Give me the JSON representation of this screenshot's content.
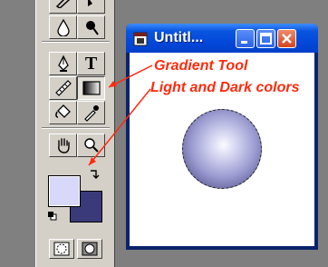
{
  "document_window": {
    "title": "Untitl...",
    "buttons": [
      "minimize",
      "maximize",
      "close"
    ]
  },
  "toolbox": {
    "tools": [
      {
        "name": "pencil-tool",
        "icon": "pencil-icon"
      },
      {
        "name": "bucket-tool",
        "icon": "bucket-icon"
      },
      {
        "name": "blur-tool",
        "icon": "drop-icon"
      },
      {
        "name": "burn-tool",
        "icon": "burn-icon"
      },
      {
        "name": "pen-tool",
        "icon": "pen-icon"
      },
      {
        "name": "type-tool",
        "icon": "type-icon"
      },
      {
        "name": "measure-tool",
        "icon": "ruler-icon"
      },
      {
        "name": "gradient-tool",
        "icon": "gradient-icon",
        "selected": true
      },
      {
        "name": "paint-bucket-tool",
        "icon": "paint-bucket-icon"
      },
      {
        "name": "eyedropper-tool",
        "icon": "eyedropper-icon"
      },
      {
        "name": "hand-tool",
        "icon": "hand-icon"
      },
      {
        "name": "zoom-tool",
        "icon": "magnifier-icon"
      },
      {
        "name": "standard-mode",
        "icon": "standard-mode-icon"
      },
      {
        "name": "quick-mask-mode",
        "icon": "quick-mask-icon"
      }
    ],
    "type_tool_glyph": "T",
    "foreground_color": "#d8d8f8",
    "background_color": "#3a3a7a"
  },
  "callouts": {
    "gradient_tool": "Gradient Tool",
    "light_dark_colors": "Light and Dark colors",
    "color": "#ff2a0d"
  }
}
